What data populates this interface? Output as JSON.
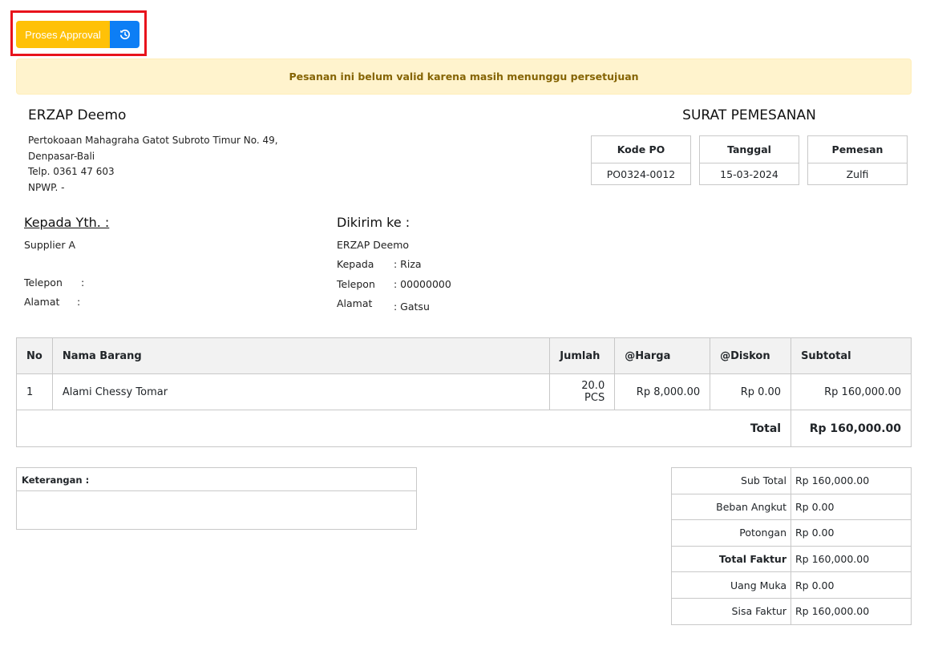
{
  "toolbar": {
    "approval_label": "Proses Approval",
    "history_icon": "history-icon"
  },
  "alert": {
    "text": "Pesanan ini belum valid karena masih menunggu persetujuan"
  },
  "company": {
    "name": "ERZAP Deemo",
    "address_line1": "Pertokoaan Mahagraha Gatot Subroto Timur No. 49,",
    "address_line2": "Denpasar-Bali",
    "phone": "Telp. 0361 47 603",
    "npwp": "NPWP. -"
  },
  "document": {
    "title": "SURAT PEMESANAN",
    "kode_po_label": "Kode PO",
    "kode_po_value": "PO0324-0012",
    "tanggal_label": "Tanggal",
    "tanggal_value": "15-03-2024",
    "pemesan_label": "Pemesan",
    "pemesan_value": "Zulfi"
  },
  "recipient": {
    "title": "Kepada Yth. :",
    "name": "Supplier A",
    "telepon_label": "Telepon",
    "telepon_sep": ":",
    "alamat_label": "Alamat",
    "alamat_sep": ":"
  },
  "shipping": {
    "title": "Dikirim ke :",
    "name": "ERZAP Deemo",
    "kepada_label": "Kepada",
    "kepada_value": ": Riza",
    "telepon_label": "Telepon",
    "telepon_value": ": 00000000",
    "alamat_label": "Alamat",
    "alamat_value": ": Gatsu"
  },
  "items": {
    "headers": {
      "no": "No",
      "nama": "Nama Barang",
      "jumlah": "Jumlah",
      "harga": "@Harga",
      "diskon": "@Diskon",
      "subtotal": "Subtotal"
    },
    "rows": [
      {
        "no": "1",
        "nama": "Alami Chessy Tomar",
        "jumlah": "20.0 PCS",
        "harga": "Rp 8,000.00",
        "diskon": "Rp 0.00",
        "subtotal": "Rp 160,000.00"
      }
    ],
    "total_label": "Total",
    "total_value": "Rp 160,000.00"
  },
  "notes": {
    "label": "Keterangan :"
  },
  "summary": {
    "sub_total_label": "Sub Total",
    "sub_total_value": "Rp 160,000.00",
    "beban_angkut_label": "Beban Angkut",
    "beban_angkut_value": "Rp 0.00",
    "potongan_label": "Potongan",
    "potongan_value": "Rp 0.00",
    "total_faktur_label": "Total Faktur",
    "total_faktur_value": "Rp 160,000.00",
    "uang_muka_label": "Uang Muka",
    "uang_muka_value": "Rp 0.00",
    "sisa_faktur_label": "Sisa Faktur",
    "sisa_faktur_value": "Rp 160,000.00"
  }
}
